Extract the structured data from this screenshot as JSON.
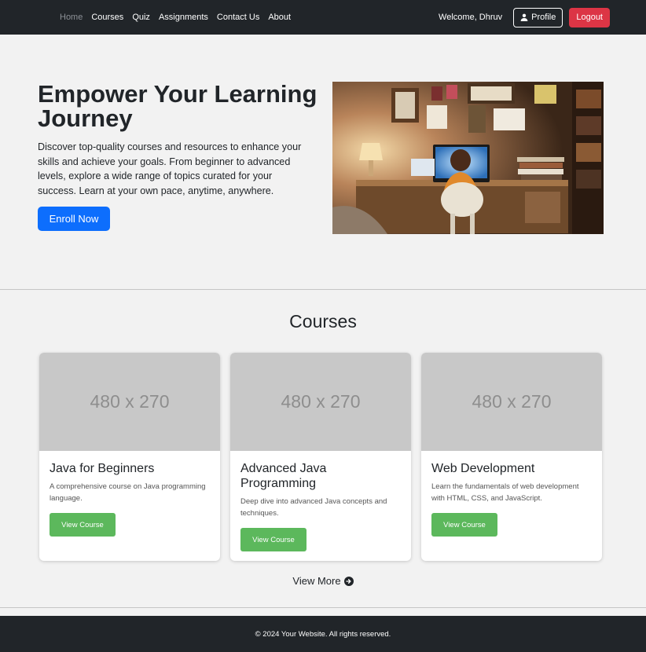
{
  "nav": {
    "links": [
      "Home",
      "Courses",
      "Quiz",
      "Assignments",
      "Contact Us",
      "About"
    ],
    "welcome": "Welcome, Dhruv",
    "profile_label": "Profile",
    "logout_label": "Logout"
  },
  "hero": {
    "title": "Empower Your Learning Journey",
    "text": "Discover top-quality courses and resources to enhance your skills and achieve your goals. From beginner to advanced levels, explore a wide range of topics curated for your success. Learn at your own pace, anytime, anywhere.",
    "cta_label": "Enroll Now"
  },
  "courses": {
    "heading": "Courses",
    "items": [
      {
        "image_label": "480 x 270",
        "title": "Java for Beginners",
        "description": "A comprehensive course on Java programming language.",
        "button_label": "View Course"
      },
      {
        "image_label": "480 x 270",
        "title": "Advanced Java Programming",
        "description": "Deep dive into advanced Java concepts and techniques.",
        "button_label": "View Course"
      },
      {
        "image_label": "480 x 270",
        "title": "Web Development",
        "description": "Learn the fundamentals of web development with HTML, CSS, and JavaScript.",
        "button_label": "View Course"
      }
    ],
    "view_more_label": "View More"
  },
  "footer": {
    "text": "© 2024 Your Website. All rights reserved."
  },
  "colors": {
    "navbar": "#212529",
    "primary": "#0d6efd",
    "danger": "#dc3545",
    "success": "#5cb85c",
    "page_bg": "#f2f2f2"
  },
  "icons": {
    "profile": "user-icon",
    "view_more": "arrow-circle-right-icon"
  }
}
